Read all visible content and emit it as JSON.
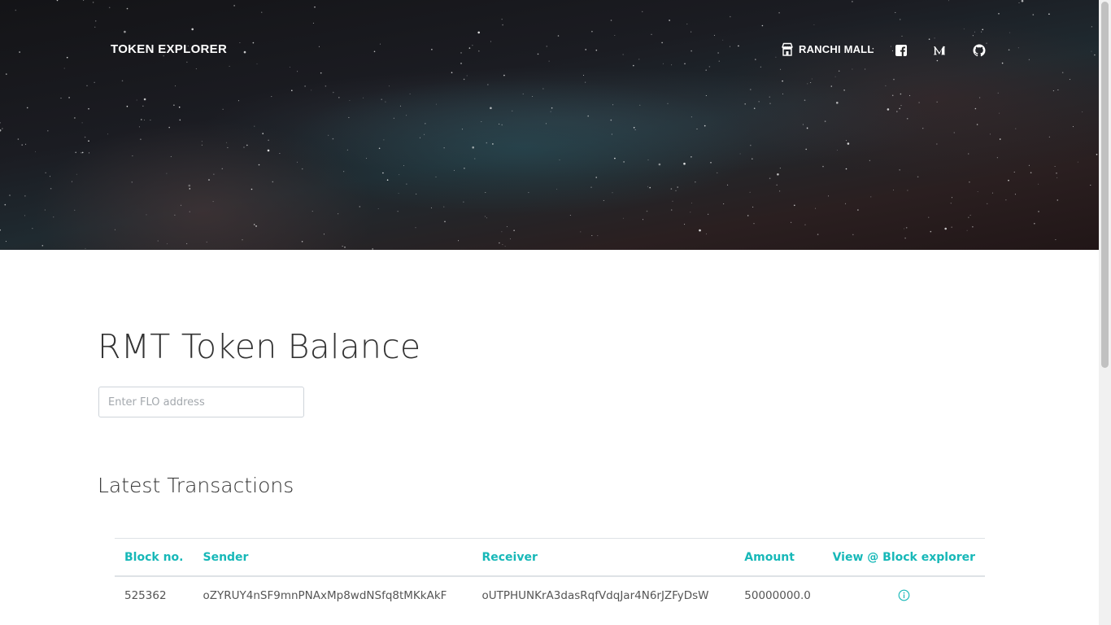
{
  "nav": {
    "brand": "TOKEN EXPLORER",
    "ranchi_mall_label": "RANCHI MALL",
    "icons": [
      "store-icon",
      "facebook-icon",
      "medium-icon",
      "github-icon"
    ]
  },
  "main": {
    "title": "RMT Token Balance",
    "address_input": {
      "placeholder": "Enter FLO address",
      "value": ""
    },
    "transactions_title": "Latest Transactions"
  },
  "transactions": {
    "headers": {
      "block": "Block no.",
      "sender": "Sender",
      "receiver": "Receiver",
      "amount": "Amount",
      "view": "View @ Block explorer"
    },
    "rows": [
      {
        "block": "525362",
        "sender": "oZYRUY4nSF9mnPNAxMp8wdNSfq8tMKkAkF",
        "receiver": "oUTPHUNKrA3dasRqfVdqJar4N6rJZFyDsW",
        "amount": "50000000.0",
        "view_icon": "info-icon"
      }
    ]
  },
  "colors": {
    "accent": "#17b8b8",
    "hero_background": "#1c1d22",
    "text": "#333333"
  }
}
